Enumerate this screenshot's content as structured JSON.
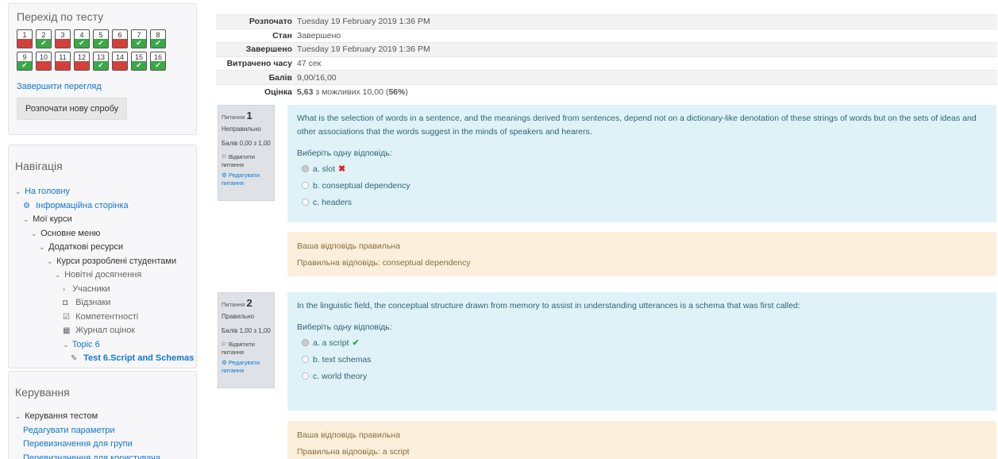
{
  "quiz_nav": {
    "title": "Перехід по тесту",
    "buttons": [
      {
        "num": "1",
        "state": "incorrect"
      },
      {
        "num": "2",
        "state": "correct"
      },
      {
        "num": "3",
        "state": "incorrect"
      },
      {
        "num": "4",
        "state": "correct"
      },
      {
        "num": "5",
        "state": "correct"
      },
      {
        "num": "6",
        "state": "incorrect"
      },
      {
        "num": "7",
        "state": "correct"
      },
      {
        "num": "8",
        "state": "correct"
      },
      {
        "num": "9",
        "state": "correct"
      },
      {
        "num": "10",
        "state": "incorrect"
      },
      {
        "num": "11",
        "state": "incorrect"
      },
      {
        "num": "12",
        "state": "incorrect"
      },
      {
        "num": "13",
        "state": "correct"
      },
      {
        "num": "14",
        "state": "incorrect"
      },
      {
        "num": "15",
        "state": "correct"
      },
      {
        "num": "16",
        "state": "correct"
      }
    ],
    "finish_review": "Завершити перегляд",
    "new_attempt": "Розпочати нову спробу"
  },
  "navigation": {
    "title": "Навігація",
    "items": [
      {
        "label": "На головну",
        "chev": "⌄",
        "icon": "",
        "indent": 0,
        "style": "blue"
      },
      {
        "label": "Інформаційна сторінка",
        "chev": "",
        "icon": "⚙",
        "indent": 1,
        "style": "blue"
      },
      {
        "label": "Мої курси",
        "chev": "⌄",
        "icon": "",
        "indent": 1,
        "style": "dark"
      },
      {
        "label": "Основне меню",
        "chev": "⌄",
        "icon": "",
        "indent": 2,
        "style": "dark"
      },
      {
        "label": "Додаткові ресурси",
        "chev": "⌄",
        "icon": "",
        "indent": 3,
        "style": "dark"
      },
      {
        "label": "Курси розроблені студентами",
        "chev": "⌄",
        "icon": "",
        "indent": 4,
        "style": "dark"
      },
      {
        "label": "Новітні досягнення",
        "chev": "⌄",
        "icon": "",
        "indent": 5,
        "style": "grey"
      },
      {
        "label": "Учасники",
        "chev": "›",
        "icon": "",
        "indent": 6,
        "style": "grey"
      },
      {
        "label": "Відзнаки",
        "chev": "",
        "icon": "◘",
        "indent": 6,
        "style": "grey"
      },
      {
        "label": "Компетентності",
        "chev": "",
        "icon": "☑",
        "indent": 6,
        "style": "grey"
      },
      {
        "label": "Журнал оцінок",
        "chev": "",
        "icon": "▦",
        "indent": 6,
        "style": "grey"
      },
      {
        "label": "Topic 6",
        "chev": "⌄",
        "icon": "",
        "indent": 6,
        "style": "blue"
      },
      {
        "label": "Test 6.Script and Schemas",
        "chev": "",
        "icon": "✎",
        "indent": 7,
        "style": "bold"
      }
    ]
  },
  "admin": {
    "title": "Керування",
    "items": [
      {
        "label": "Керування тестом",
        "chev": "⌄",
        "indent": 0,
        "style": "dark"
      },
      {
        "label": "Редагувати параметри",
        "chev": "",
        "indent": 1,
        "style": "blue"
      },
      {
        "label": "Перевизначення для групи",
        "chev": "",
        "indent": 1,
        "style": "blue"
      },
      {
        "label": "Перевизначення для користувача",
        "chev": "",
        "indent": 1,
        "style": "blue"
      }
    ]
  },
  "summary": [
    {
      "label": "Розпочато",
      "value": "Tuesday 19 February 2019 1:36 PM"
    },
    {
      "label": "Стан",
      "value": "Завершено"
    },
    {
      "label": "Завершено",
      "value": "Tuesday 19 February 2019 1:36 PM"
    },
    {
      "label": "Витрачено часу",
      "value": "47 сек"
    },
    {
      "label": "Балів",
      "value": "9,00/16,00"
    },
    {
      "label": "Оцінка",
      "value_bold": "5,63",
      "value_rest": " з можливих 10,00 (",
      "percent": "56%",
      "close": ")"
    }
  ],
  "questions": [
    {
      "label": "Питання",
      "number": "1",
      "state": "Неправильно",
      "marks": "Балів 0,00 з 1,00",
      "flag": "Відмітити питання",
      "edit": "Редагувати питання",
      "text": "What is the selection of words in a sentence, and the meanings derived from sentences, depend not on a dictionary-like denotation of these strings of words but on the sets of ideas and other associations that the words suggest in the minds of speakers and hearers.",
      "prompt": "Виберіть одну відповідь:",
      "answers": [
        {
          "text": "a. slot",
          "checked": true,
          "mark": "✖"
        },
        {
          "text": "b. conseptual dependency",
          "checked": false,
          "mark": ""
        },
        {
          "text": "c. headers",
          "checked": false,
          "mark": ""
        }
      ],
      "feedback_1": "Ваша відповідь правильна",
      "feedback_2": "Правильна відповідь: conseptual dependency"
    },
    {
      "label": "Питання",
      "number": "2",
      "state": "Правильно",
      "marks": "Балів 1,00 з 1,00",
      "flag": "Відмітити питання",
      "edit": "Редагувати питання",
      "text": "In the linguistic field, the conceptual structure drawn from memory to assist in understanding utterances is a schema that was first called:",
      "prompt": "Виберіть одну відповідь:",
      "answers": [
        {
          "text": "a. a script",
          "checked": true,
          "mark": "✔"
        },
        {
          "text": "b. text schemas",
          "checked": false,
          "mark": ""
        },
        {
          "text": "c. world theory",
          "checked": false,
          "mark": ""
        }
      ],
      "feedback_1": "Ваша відповідь правильна",
      "feedback_2": "Правильна відповідь: a script"
    }
  ]
}
